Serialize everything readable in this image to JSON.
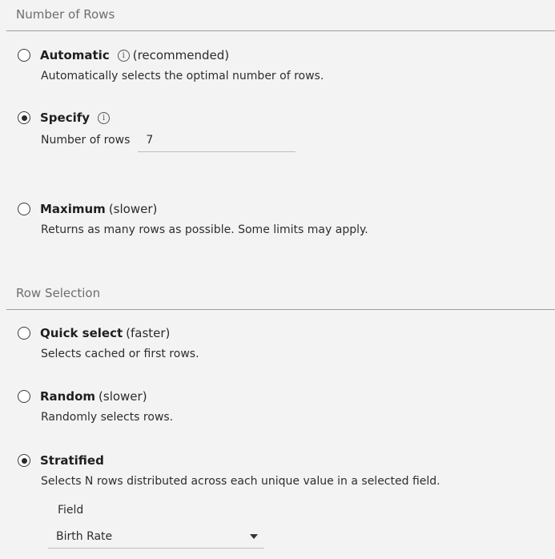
{
  "number_of_rows": {
    "header": "Number of Rows",
    "options": [
      {
        "title": "Automatic",
        "note": "(recommended)",
        "description": "Automatically selects the optimal number of rows.",
        "selected": false,
        "has_info_icon": true
      },
      {
        "title": "Specify",
        "note": "",
        "selected": true,
        "has_info_icon": true,
        "rows_label": "Number of rows",
        "rows_value": "7"
      },
      {
        "title": "Maximum",
        "note": "(slower)",
        "description": "Returns as many rows as possible. Some limits may apply.",
        "selected": false,
        "has_info_icon": false
      }
    ]
  },
  "row_selection": {
    "header": "Row Selection",
    "options": [
      {
        "title": "Quick select",
        "note": "(faster)",
        "description": "Selects cached or first rows.",
        "selected": false
      },
      {
        "title": "Random",
        "note": "(slower)",
        "description": "Randomly selects rows.",
        "selected": false
      },
      {
        "title": "Stratified",
        "note": "",
        "description": "Selects N rows distributed across each unique value in a selected field.",
        "selected": true
      }
    ],
    "field_label": "Field",
    "field_value": "Birth Rate"
  },
  "icons": {
    "info": "info-icon",
    "dropdown": "caret-down-icon"
  },
  "colors": {
    "background": "#f3f3f3",
    "divider": "#9e9e9e",
    "header_text": "#6e6e6e"
  }
}
